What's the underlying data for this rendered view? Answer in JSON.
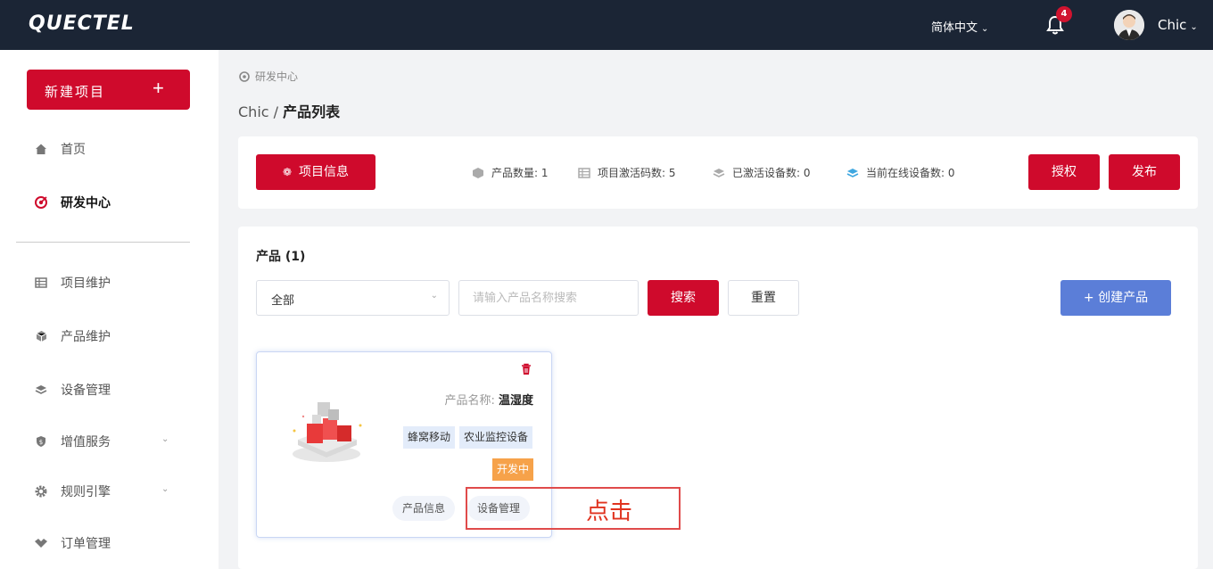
{
  "header": {
    "logo": "QUECTEL",
    "language": "简体中文",
    "notification_count": "4",
    "user_name": "Chic"
  },
  "sidebar": {
    "new_project_label": "新建项目",
    "items": [
      {
        "label": "首页",
        "icon": "home-icon"
      },
      {
        "label": "研发中心",
        "icon": "target-icon",
        "active": true
      },
      {
        "label": "项目维护",
        "icon": "table-icon"
      },
      {
        "label": "产品维护",
        "icon": "cube-icon"
      },
      {
        "label": "设备管理",
        "icon": "layers-icon"
      },
      {
        "label": "增值服务",
        "icon": "shield-icon",
        "expandable": true
      },
      {
        "label": "规则引擎",
        "icon": "gear-icon",
        "expandable": true
      },
      {
        "label": "订单管理",
        "icon": "handshake-icon"
      }
    ]
  },
  "breadcrumb": {
    "section": "研发中心",
    "project": "Chic",
    "separator": "/",
    "page": "产品列表"
  },
  "info_bar": {
    "project_info_label": "项目信息",
    "stats": [
      {
        "label": "产品数量",
        "value": ": 1"
      },
      {
        "label": "项目激活码数",
        "value": ": 5"
      },
      {
        "label": "已激活设备数",
        "value": ": 0"
      },
      {
        "label": "当前在线设备数",
        "value": ": 0"
      }
    ],
    "authorize_label": "授权",
    "publish_label": "发布"
  },
  "products_panel": {
    "title": "产品 (1)",
    "filter_selected": "全部",
    "search_placeholder": "请输入产品名称搜索",
    "search_label": "搜索",
    "reset_label": "重置",
    "create_label": "+ 创建产品"
  },
  "product_card": {
    "name_label": "产品名称:",
    "name_value": "温湿度",
    "tags": [
      "蜂窝移动",
      "农业监控设备"
    ],
    "status": "开发中",
    "product_info_label": "产品信息",
    "device_mgmt_label": "设备管理"
  },
  "annotation": {
    "text": "点击"
  },
  "colors": {
    "brand_red": "#cf0a2c",
    "topbar_bg": "#1b2535",
    "create_blue": "#5b7ed8",
    "status_orange": "#f6a24a"
  }
}
